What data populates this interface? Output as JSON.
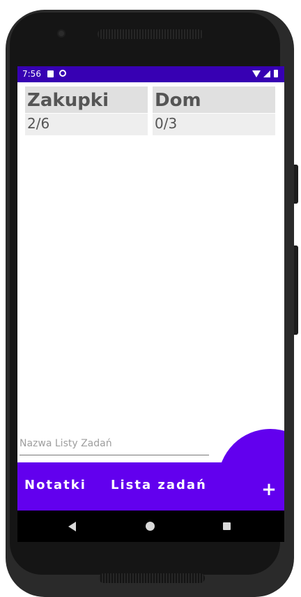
{
  "status_bar": {
    "time": "7:56"
  },
  "lists": [
    {
      "title": "Zakupki",
      "progress": "2/6"
    },
    {
      "title": "Dom",
      "progress": "0/3"
    }
  ],
  "new_list_input": {
    "value": "",
    "placeholder": "Nazwa Listy Zadań"
  },
  "bottom_bar": {
    "notes_label": "Notatki",
    "tasks_label": "Lista zadań",
    "add_label": "+"
  },
  "colors": {
    "status_bar": "#3700b3",
    "accent": "#6200ee",
    "tile_header": "#e0e0e0",
    "tile_body": "#eeeeee"
  },
  "icons": {
    "status_left": [
      "sd-card-icon",
      "do-not-disturb-icon"
    ],
    "status_right": [
      "wifi-icon",
      "signal-icon",
      "battery-icon"
    ],
    "nav": [
      "back-icon",
      "home-icon",
      "recents-icon"
    ]
  }
}
